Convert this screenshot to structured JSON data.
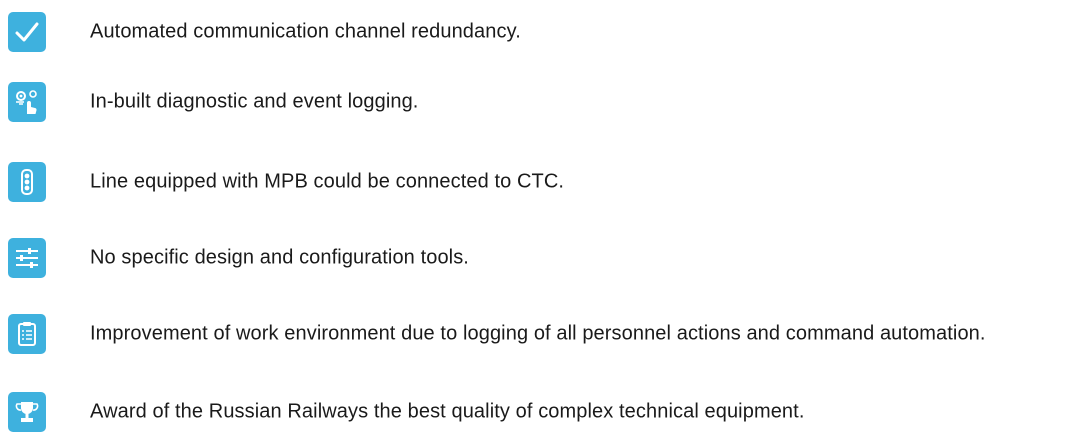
{
  "features": [
    {
      "icon": "checkmark-icon",
      "text": "Automated communication channel redundancy."
    },
    {
      "icon": "gears-touch-icon",
      "text": "In-built diagnostic and event logging."
    },
    {
      "icon": "traffic-light-icon",
      "text": "Line equipped with MPB could be connected to CTC."
    },
    {
      "icon": "sliders-icon",
      "text": "No specific design and configuration tools."
    },
    {
      "icon": "clipboard-list-icon",
      "text": "Improvement of work environment due to logging of all personnel actions and command automation."
    },
    {
      "icon": "trophy-icon",
      "text": "Award of the Russian Railways the best quality of complex technical equipment."
    }
  ],
  "colors": {
    "icon_bg": "#3eb1de",
    "icon_fg": "#ffffff",
    "text": "#1a1a1a"
  }
}
